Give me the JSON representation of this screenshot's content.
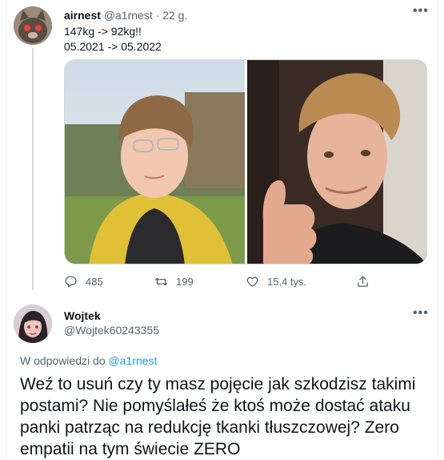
{
  "tweet": {
    "author_name": "airnest",
    "author_handle": "@a1rnest",
    "separator": "·",
    "time": "22 g.",
    "text_lines": [
      "147kg -> 92kg!!",
      "05.2021 -> 05.2022"
    ],
    "actions": {
      "reply_count": "485",
      "retweet_count": "199",
      "like_count": "15,4 tys."
    },
    "more_label": "•••"
  },
  "reply": {
    "author_name": "Wojtek",
    "author_handle": "@Wojtek60243355",
    "more_label": "•••",
    "replying_to_prefix": "W odpowiedzi do",
    "replying_to_handle": "@a1rnest",
    "text": "Weź to usuń czy ty masz pojęcie jak szkodzisz takimi postami? Nie pomyślałeś że ktoś może dostać ataku panki patrząc na redukcję tkanki tłuszczowej? Zero empatii na tym świecie ZERO"
  },
  "icons": {
    "reply": "reply-icon",
    "retweet": "retweet-icon",
    "like": "heart-icon",
    "share": "share-icon",
    "more": "more-icon"
  },
  "colors": {
    "text": "#0f1419",
    "secondary": "#536471",
    "link": "#1d9bf0",
    "border": "#cfd9de"
  }
}
